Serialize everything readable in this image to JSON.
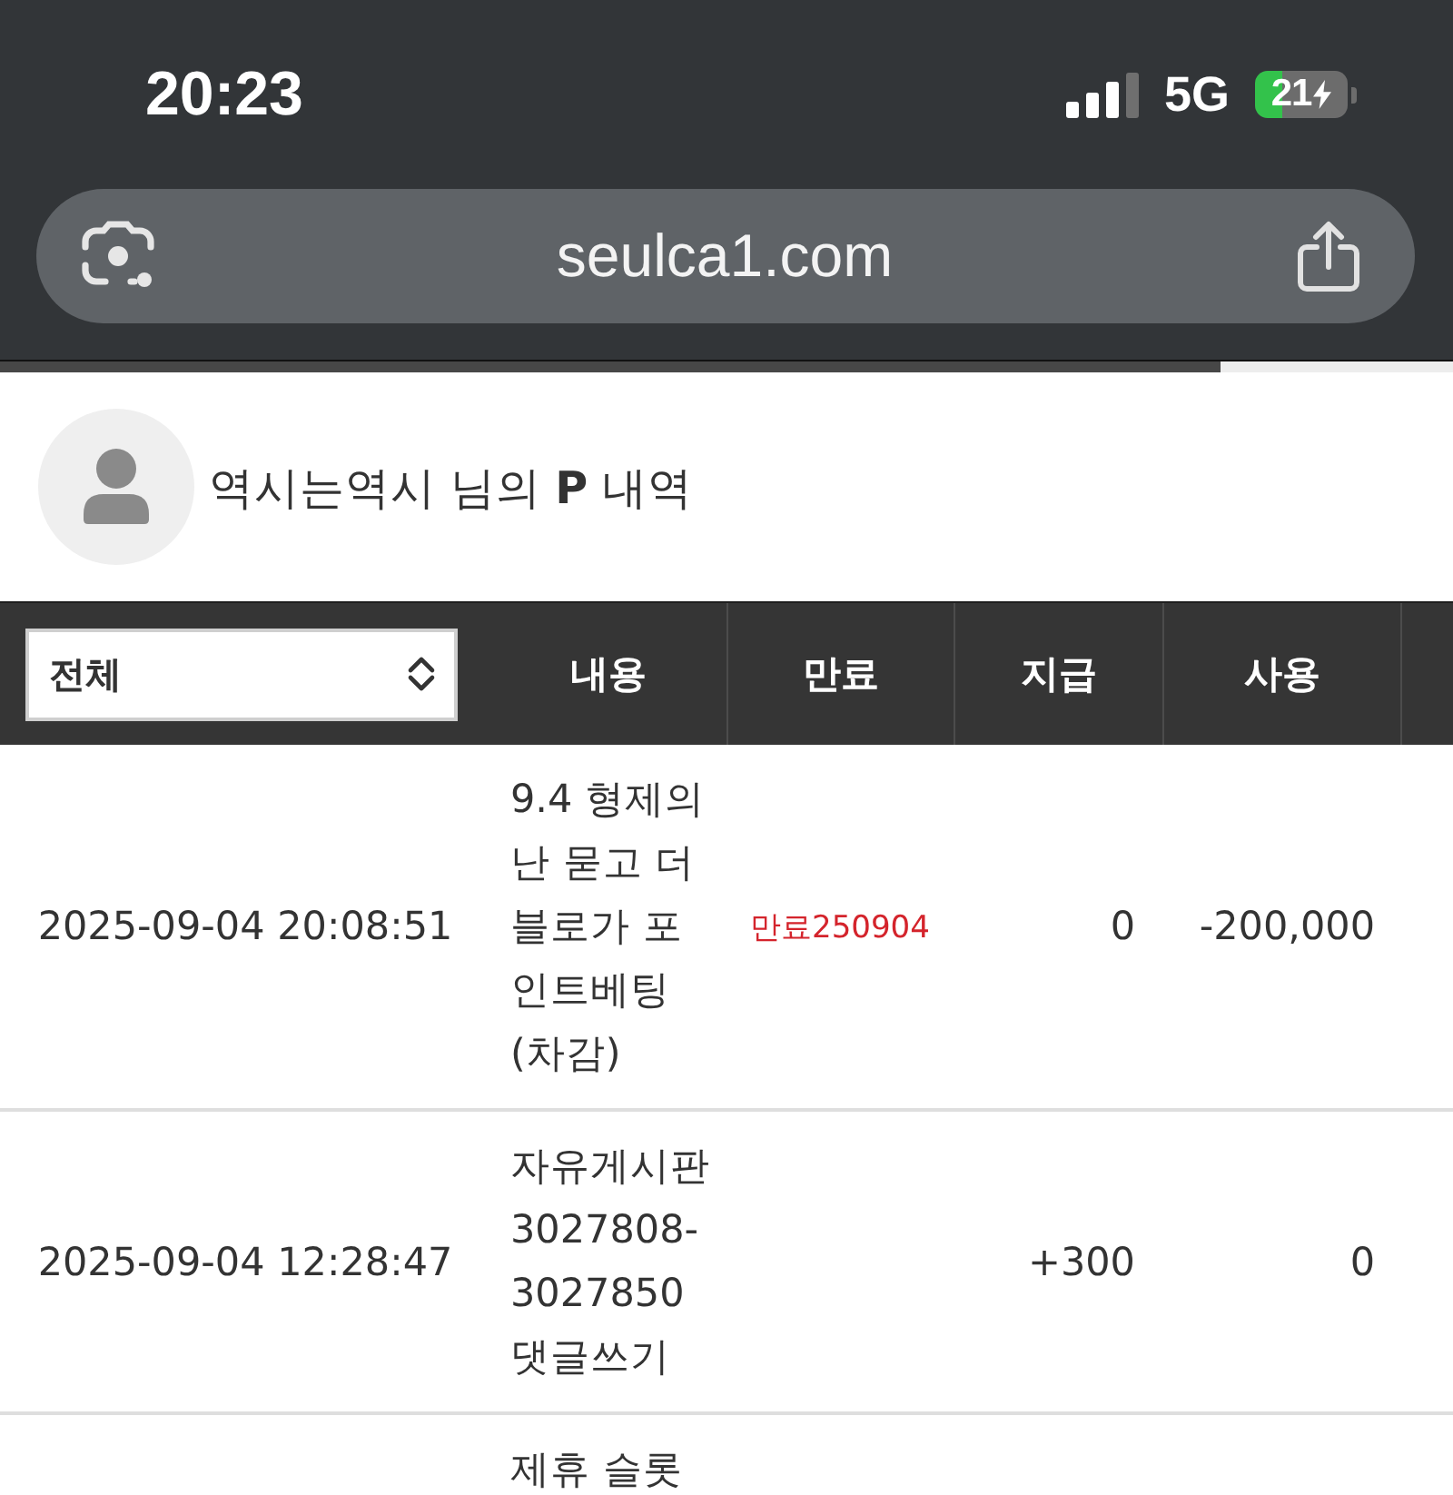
{
  "status_bar": {
    "time": "20:23",
    "network": "5G",
    "battery": "21"
  },
  "address_bar": {
    "url": "seulca1.com"
  },
  "page_load": {
    "level": 0.84
  },
  "profile": {
    "title": "역시는역시 님의 **P** 내역"
  },
  "table": {
    "filter": {
      "value": "전체"
    },
    "columns": [
      "내용",
      "만료",
      "지급",
      "사용"
    ],
    "rows": [
      {
        "date": "2025-09-04 20:08:51",
        "content": "9.4 형제의 난 묻고 더블로가 포인트베팅(차감)",
        "expiry": "만료250904",
        "paid": "0",
        "used": "-200,000"
      },
      {
        "date": "2025-09-04 12:28:47",
        "content": "자유게시판 3027808-3027850 댓글쓰기",
        "paid": "+300",
        "used": "0"
      },
      {
        "content": "제휴 슬롯"
      }
    ]
  }
}
